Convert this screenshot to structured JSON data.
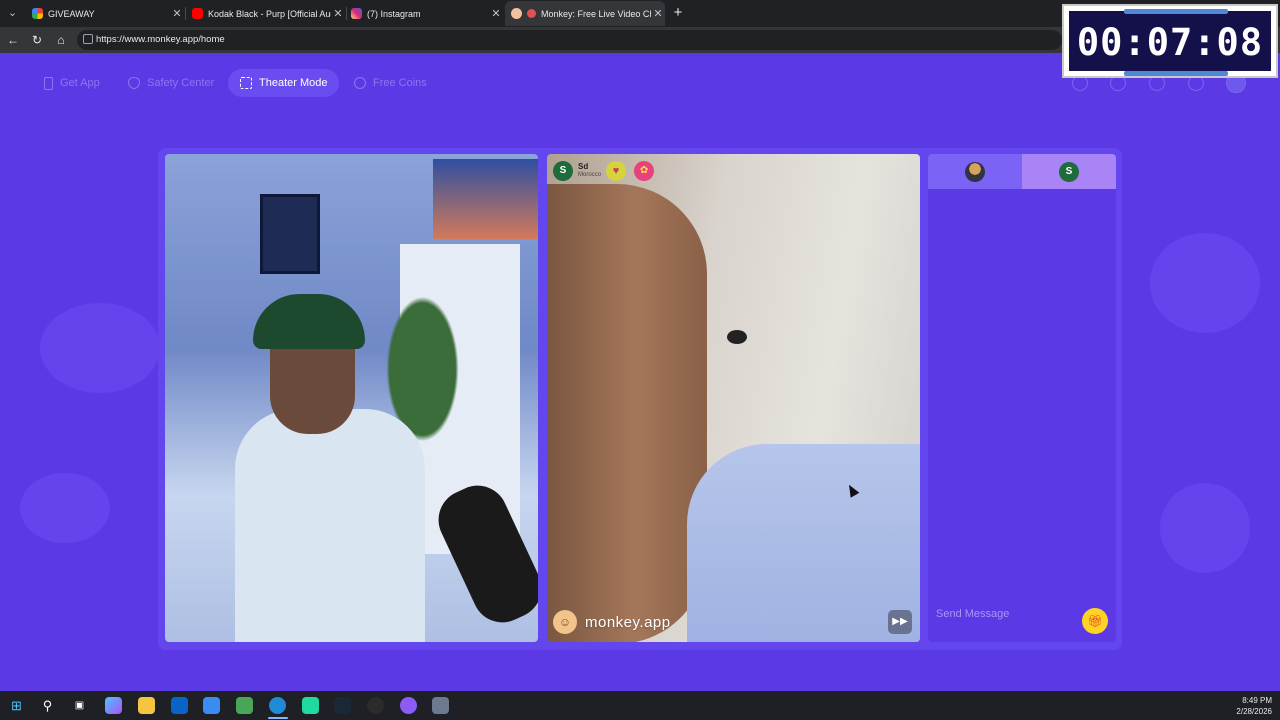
{
  "browser": {
    "tabs": [
      {
        "title": "GIVEAWAY",
        "favicon_color": "#f4b400",
        "active": false
      },
      {
        "title": "Kodak Black - Purp [Official Audio]",
        "favicon_color": "#ff0000",
        "active": false
      },
      {
        "title": "(7) Instagram",
        "favicon_color": "#d6249f",
        "active": false
      },
      {
        "title": "Monkey: Free Live Video Chat",
        "favicon_color": "#e8a0a0",
        "active": true
      }
    ],
    "url": "https://www.monkey.app/home"
  },
  "overlay": {
    "timer": "00:07:08"
  },
  "site": {
    "nav": [
      {
        "label": "Get App",
        "active": false
      },
      {
        "label": "Safety Center",
        "active": false
      },
      {
        "label": "Theater Mode",
        "active": true
      },
      {
        "label": "Free Coins",
        "active": false
      }
    ],
    "peer": {
      "initial": "S",
      "name": "Sd",
      "location": "Morocco"
    },
    "brand": "monkey.app",
    "chat": {
      "tab2_initial": "S",
      "placeholder": "Send Message"
    }
  },
  "taskbar": {
    "time": "8:49 PM",
    "date": "2/28/2026"
  },
  "colors": {
    "site_bg": "#5b3ae6",
    "stage_bg": "#6446ee",
    "accent_gift": "#ffd323",
    "timer_bg": "#14104a"
  }
}
